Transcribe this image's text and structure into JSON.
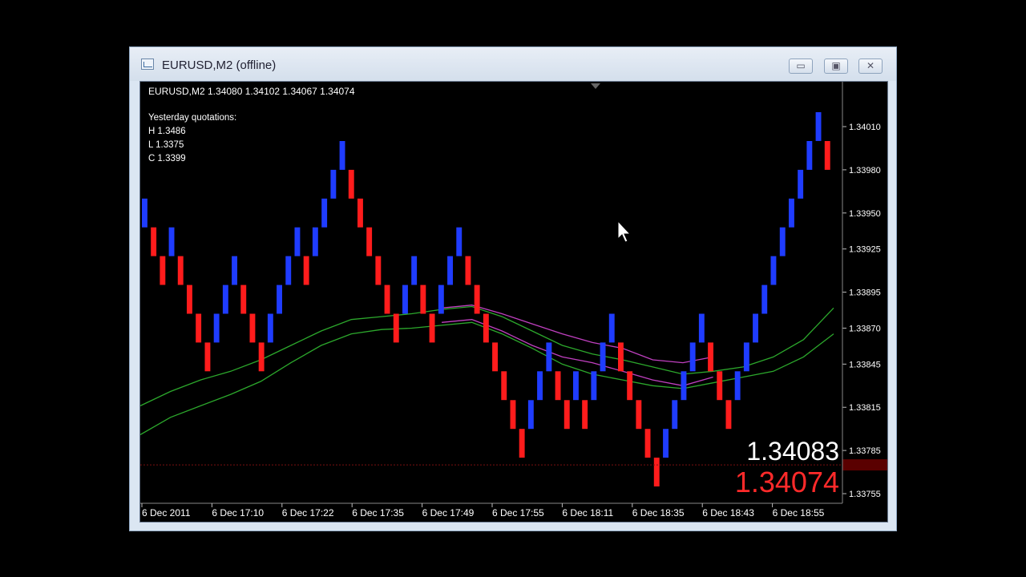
{
  "window": {
    "title": "EURUSD,M2 (offline)",
    "buttons": {
      "minimize": "▭",
      "maximize": "▣",
      "close": "✕"
    }
  },
  "info": {
    "header": "EURUSD,M2  1.34080 1.34102 1.34067 1.34074",
    "yesterday_label": "Yesterday quotations:",
    "high": "H 1.3486",
    "low": "L 1.3375",
    "close": "C 1.3399"
  },
  "price_labels": {
    "bid": "1.34083",
    "ask": "1.34074"
  },
  "chart_data": {
    "type": "renko",
    "y_ticks": [
      "1.34010",
      "1.33980",
      "1.33950",
      "1.33925",
      "1.33895",
      "1.33870",
      "1.33845",
      "1.33815",
      "1.33785",
      "1.33755"
    ],
    "y_tick_values": [
      1.3401,
      1.3398,
      1.3395,
      1.33925,
      1.33895,
      1.3387,
      1.33845,
      1.33815,
      1.33785,
      1.33755
    ],
    "x_ticks": [
      "6 Dec 2011",
      "6 Dec 17:10",
      "6 Dec 17:22",
      "6 Dec 17:35",
      "6 Dec 17:49",
      "6 Dec 17:55",
      "6 Dec 18:11",
      "6 Dec 18:35",
      "6 Dec 18:43",
      "6 Dec 18:55"
    ],
    "brick_size": 0.0002,
    "bricks": [
      {
        "open": 1.3394,
        "close": 1.3396,
        "dir": "up"
      },
      {
        "open": 1.3394,
        "close": 1.3392,
        "dir": "down"
      },
      {
        "open": 1.3392,
        "close": 1.339,
        "dir": "down"
      },
      {
        "open": 1.3392,
        "close": 1.3394,
        "dir": "up"
      },
      {
        "open": 1.3392,
        "close": 1.339,
        "dir": "down"
      },
      {
        "open": 1.339,
        "close": 1.3388,
        "dir": "down"
      },
      {
        "open": 1.3388,
        "close": 1.3386,
        "dir": "down"
      },
      {
        "open": 1.3386,
        "close": 1.3384,
        "dir": "down"
      },
      {
        "open": 1.3386,
        "close": 1.3388,
        "dir": "up"
      },
      {
        "open": 1.3388,
        "close": 1.339,
        "dir": "up"
      },
      {
        "open": 1.339,
        "close": 1.3392,
        "dir": "up"
      },
      {
        "open": 1.339,
        "close": 1.3388,
        "dir": "down"
      },
      {
        "open": 1.3388,
        "close": 1.3386,
        "dir": "down"
      },
      {
        "open": 1.3386,
        "close": 1.3384,
        "dir": "down"
      },
      {
        "open": 1.3386,
        "close": 1.3388,
        "dir": "up"
      },
      {
        "open": 1.3388,
        "close": 1.339,
        "dir": "up"
      },
      {
        "open": 1.339,
        "close": 1.3392,
        "dir": "up"
      },
      {
        "open": 1.3392,
        "close": 1.3394,
        "dir": "up"
      },
      {
        "open": 1.3392,
        "close": 1.339,
        "dir": "down"
      },
      {
        "open": 1.3392,
        "close": 1.3394,
        "dir": "up"
      },
      {
        "open": 1.3394,
        "close": 1.3396,
        "dir": "up"
      },
      {
        "open": 1.3396,
        "close": 1.3398,
        "dir": "up"
      },
      {
        "open": 1.3398,
        "close": 1.34,
        "dir": "up"
      },
      {
        "open": 1.3398,
        "close": 1.3396,
        "dir": "down"
      },
      {
        "open": 1.3396,
        "close": 1.3394,
        "dir": "down"
      },
      {
        "open": 1.3394,
        "close": 1.3392,
        "dir": "down"
      },
      {
        "open": 1.3392,
        "close": 1.339,
        "dir": "down"
      },
      {
        "open": 1.339,
        "close": 1.3388,
        "dir": "down"
      },
      {
        "open": 1.3388,
        "close": 1.3386,
        "dir": "down"
      },
      {
        "open": 1.3388,
        "close": 1.339,
        "dir": "up"
      },
      {
        "open": 1.339,
        "close": 1.3392,
        "dir": "up"
      },
      {
        "open": 1.339,
        "close": 1.3388,
        "dir": "down"
      },
      {
        "open": 1.3388,
        "close": 1.3386,
        "dir": "down"
      },
      {
        "open": 1.3388,
        "close": 1.339,
        "dir": "up"
      },
      {
        "open": 1.339,
        "close": 1.3392,
        "dir": "up"
      },
      {
        "open": 1.3392,
        "close": 1.3394,
        "dir": "up"
      },
      {
        "open": 1.3392,
        "close": 1.339,
        "dir": "down"
      },
      {
        "open": 1.339,
        "close": 1.3388,
        "dir": "down"
      },
      {
        "open": 1.3388,
        "close": 1.3386,
        "dir": "down"
      },
      {
        "open": 1.3386,
        "close": 1.3384,
        "dir": "down"
      },
      {
        "open": 1.3384,
        "close": 1.3382,
        "dir": "down"
      },
      {
        "open": 1.3382,
        "close": 1.338,
        "dir": "down"
      },
      {
        "open": 1.338,
        "close": 1.3378,
        "dir": "down"
      },
      {
        "open": 1.338,
        "close": 1.3382,
        "dir": "up"
      },
      {
        "open": 1.3382,
        "close": 1.3384,
        "dir": "up"
      },
      {
        "open": 1.3384,
        "close": 1.3386,
        "dir": "up"
      },
      {
        "open": 1.3384,
        "close": 1.3382,
        "dir": "down"
      },
      {
        "open": 1.3382,
        "close": 1.338,
        "dir": "down"
      },
      {
        "open": 1.3382,
        "close": 1.3384,
        "dir": "up"
      },
      {
        "open": 1.3382,
        "close": 1.338,
        "dir": "down"
      },
      {
        "open": 1.3382,
        "close": 1.3384,
        "dir": "up"
      },
      {
        "open": 1.3384,
        "close": 1.3386,
        "dir": "up"
      },
      {
        "open": 1.3386,
        "close": 1.3388,
        "dir": "up"
      },
      {
        "open": 1.3386,
        "close": 1.3384,
        "dir": "down"
      },
      {
        "open": 1.3384,
        "close": 1.3382,
        "dir": "down"
      },
      {
        "open": 1.3382,
        "close": 1.338,
        "dir": "down"
      },
      {
        "open": 1.338,
        "close": 1.3378,
        "dir": "down"
      },
      {
        "open": 1.3378,
        "close": 1.3376,
        "dir": "down"
      },
      {
        "open": 1.3378,
        "close": 1.338,
        "dir": "up"
      },
      {
        "open": 1.338,
        "close": 1.3382,
        "dir": "up"
      },
      {
        "open": 1.3382,
        "close": 1.3384,
        "dir": "up"
      },
      {
        "open": 1.3384,
        "close": 1.3386,
        "dir": "up"
      },
      {
        "open": 1.3386,
        "close": 1.3388,
        "dir": "up"
      },
      {
        "open": 1.3386,
        "close": 1.3384,
        "dir": "down"
      },
      {
        "open": 1.3384,
        "close": 1.3382,
        "dir": "down"
      },
      {
        "open": 1.3382,
        "close": 1.338,
        "dir": "down"
      },
      {
        "open": 1.3382,
        "close": 1.3384,
        "dir": "up"
      },
      {
        "open": 1.3384,
        "close": 1.3386,
        "dir": "up"
      },
      {
        "open": 1.3386,
        "close": 1.3388,
        "dir": "up"
      },
      {
        "open": 1.3388,
        "close": 1.339,
        "dir": "up"
      },
      {
        "open": 1.339,
        "close": 1.3392,
        "dir": "up"
      },
      {
        "open": 1.3392,
        "close": 1.3394,
        "dir": "up"
      },
      {
        "open": 1.3394,
        "close": 1.3396,
        "dir": "up"
      },
      {
        "open": 1.3396,
        "close": 1.3398,
        "dir": "up"
      },
      {
        "open": 1.3398,
        "close": 1.34,
        "dir": "up"
      },
      {
        "open": 1.34,
        "close": 1.3402,
        "dir": "up"
      },
      {
        "open": 1.34,
        "close": 1.3398,
        "dir": "down"
      }
    ],
    "ma_lines": [
      {
        "color": "#2ca82c",
        "values": [
          1.33816,
          1.33826,
          1.33834,
          1.3384,
          1.33848,
          1.33858,
          1.33868,
          1.33876,
          1.33878,
          1.3388,
          1.33883,
          1.33885,
          1.33878,
          1.33868,
          1.33858,
          1.33852,
          1.33848,
          1.33843,
          1.33838,
          1.3384,
          1.33843,
          1.3385,
          1.33862,
          1.33884
        ]
      },
      {
        "color": "#2ca82c",
        "values": [
          1.33796,
          1.33808,
          1.33816,
          1.33824,
          1.33833,
          1.33846,
          1.33858,
          1.33866,
          1.33869,
          1.3387,
          1.33872,
          1.33874,
          1.33866,
          1.33856,
          1.33845,
          1.33838,
          1.33834,
          1.3383,
          1.33828,
          1.33832,
          1.33836,
          1.3384,
          1.3385,
          1.33866
        ]
      },
      {
        "color": "#c040c0",
        "values": [
          null,
          null,
          null,
          null,
          null,
          null,
          null,
          null,
          null,
          null,
          1.33884,
          1.33886,
          1.3388,
          1.33873,
          1.33866,
          1.3386,
          1.33856,
          1.33848,
          1.33846,
          1.3385,
          null,
          null,
          null,
          null
        ]
      },
      {
        "color": "#c040c0",
        "values": [
          null,
          null,
          null,
          null,
          null,
          null,
          null,
          null,
          null,
          null,
          1.33874,
          1.33876,
          1.33868,
          1.33858,
          1.3385,
          1.33846,
          1.3384,
          1.33834,
          1.3383,
          1.33836,
          null,
          null,
          null,
          null
        ]
      }
    ],
    "current_price_line": 1.33775
  },
  "colors": {
    "up": "#1f3cff",
    "down": "#ff1c1c",
    "background": "#000000",
    "bid_label": "#ffffff",
    "ask_label": "#ff2a2a"
  },
  "icons": {
    "cursor": "mouse-pointer-icon"
  }
}
